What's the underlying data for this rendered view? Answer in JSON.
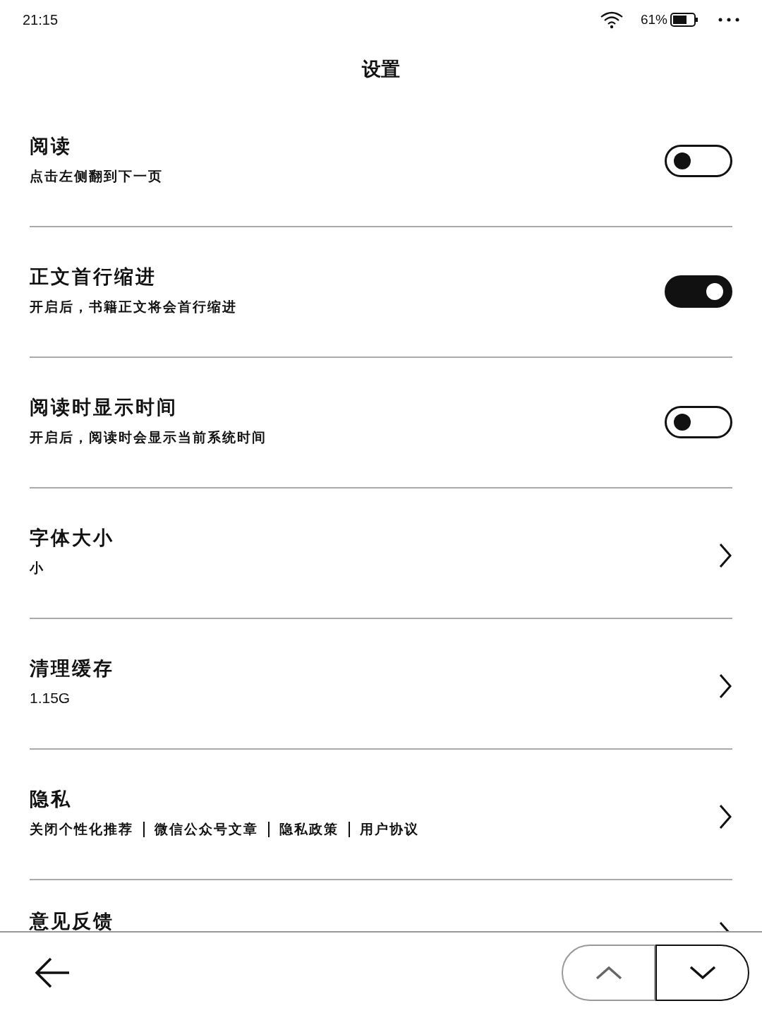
{
  "status_bar": {
    "time": "21:15",
    "battery": "61%"
  },
  "title": "设置",
  "rows": [
    {
      "kind": "toggle",
      "title": "阅读",
      "subtitle": "点击左侧翻到下一页",
      "on": false
    },
    {
      "kind": "toggle",
      "title": "正文首行缩进",
      "subtitle": "开启后，书籍正文将会首行缩进",
      "on": true
    },
    {
      "kind": "toggle",
      "title": "阅读时显示时间",
      "subtitle": "开启后，阅读时会显示当前系统时间",
      "on": false
    },
    {
      "kind": "link",
      "title": "字体大小",
      "subtitle": "小"
    },
    {
      "kind": "link",
      "title": "清理缓存",
      "value": "1.15G"
    },
    {
      "kind": "link",
      "title": "隐私",
      "links": [
        "关闭个性化推荐",
        "微信公众号文章",
        "隐私政策",
        "用户协议"
      ]
    },
    {
      "kind": "link",
      "title": "意见反馈"
    }
  ],
  "nav": {
    "up_disabled": true,
    "down_disabled": false
  }
}
